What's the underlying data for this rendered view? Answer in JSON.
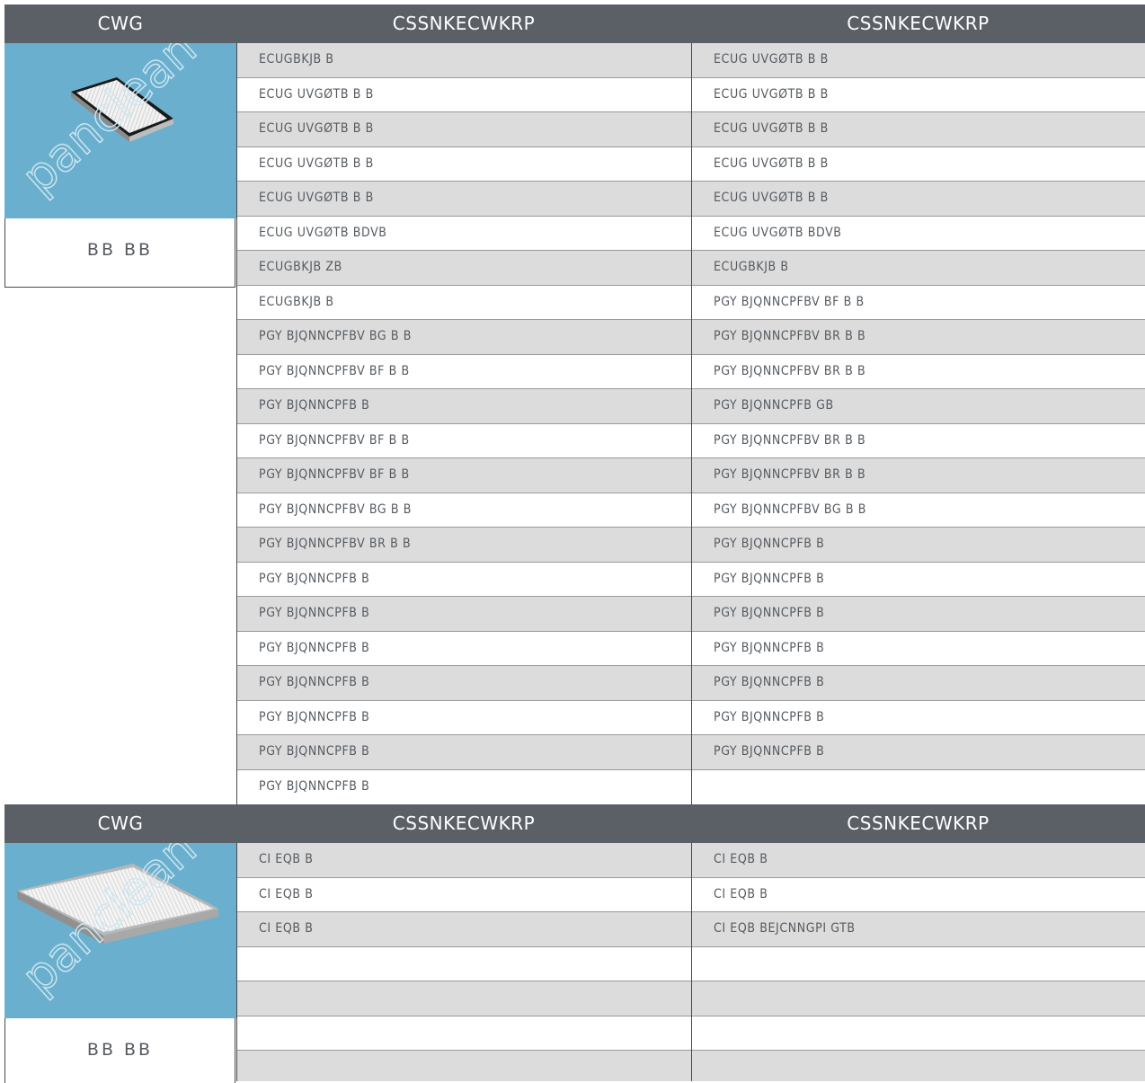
{
  "sections": [
    {
      "headers": [
        "CWG",
        "CSSNKECWKRP",
        "CSSNKECWKRP"
      ],
      "caption": "BB    BB",
      "watermark": "panclean",
      "col1": [
        "ECUGBKJB    B",
        "ECUG UVGØTB    B          B",
        "ECUG UVGØTB    B          B",
        "ECUG UVGØTB    B          B",
        "ECUG UVGØTB    B          B",
        "ECUG UVGØTB    BDVB",
        "ECUGBKJB    ZB",
        "ECUGBKJB    B",
        "PGY BJQNNCPFBV      BG    B          B",
        "PGY BJQNNCPFBV      BF    B          B",
        "PGY BJQNNCPFB  B",
        "PGY BJQNNCPFBV      BF    B          B",
        "PGY BJQNNCPFBV      BF    B          B",
        "PGY BJQNNCPFBV      BG    B          B",
        "PGY BJQNNCPFBV      BR    B          B",
        "PGY BJQNNCPFB    B",
        "PGY BJQNNCPFB    B",
        "PGY BJQNNCPFB    B",
        "PGY BJQNNCPFB    B",
        "PGY BJQNNCPFB    B",
        "PGY BJQNNCPFB    B",
        "PGY BJQNNCPFB    B"
      ],
      "col2": [
        "ECUG UVGØTB    B          B",
        "ECUG UVGØTB    B          B",
        "ECUG UVGØTB    B          B",
        "ECUG UVGØTB    B          B",
        "ECUG UVGØTB    B          B",
        "ECUG UVGØTB    BDVB",
        "ECUGBKJB    B",
        "PGY BJQNNCPFBV      BF    B          B",
        "PGY BJQNNCPFBV      BR    B          B",
        "PGY BJQNNCPFBV      BR    B          B",
        "PGY BJQNNCPFB  GB",
        "PGY BJQNNCPFBV      BR    B          B",
        "PGY BJQNNCPFBV      BR    B          B",
        "PGY BJQNNCPFBV      BG    B          B",
        "PGY BJQNNCPFB    B",
        "PGY BJQNNCPFB    B",
        "PGY BJQNNCPFB    B",
        "PGY BJQNNCPFB    B",
        "PGY BJQNNCPFB    B",
        "PGY BJQNNCPFB    B",
        "PGY BJQNNCPFB    B",
        ""
      ]
    },
    {
      "headers": [
        "CWG",
        "CSSNKECWKRP",
        "CSSNKECWKRP"
      ],
      "caption": "BB    BB",
      "watermark": "panclean",
      "col1": [
        "CI EQB      B",
        "CI EQB      B",
        "CI EQB      B",
        "",
        "",
        "",
        ""
      ],
      "col2": [
        "CI EQB      B",
        "CI EQB      B",
        "CI EQB      BEJCNNGPI GTB",
        "",
        "",
        "",
        ""
      ]
    }
  ]
}
